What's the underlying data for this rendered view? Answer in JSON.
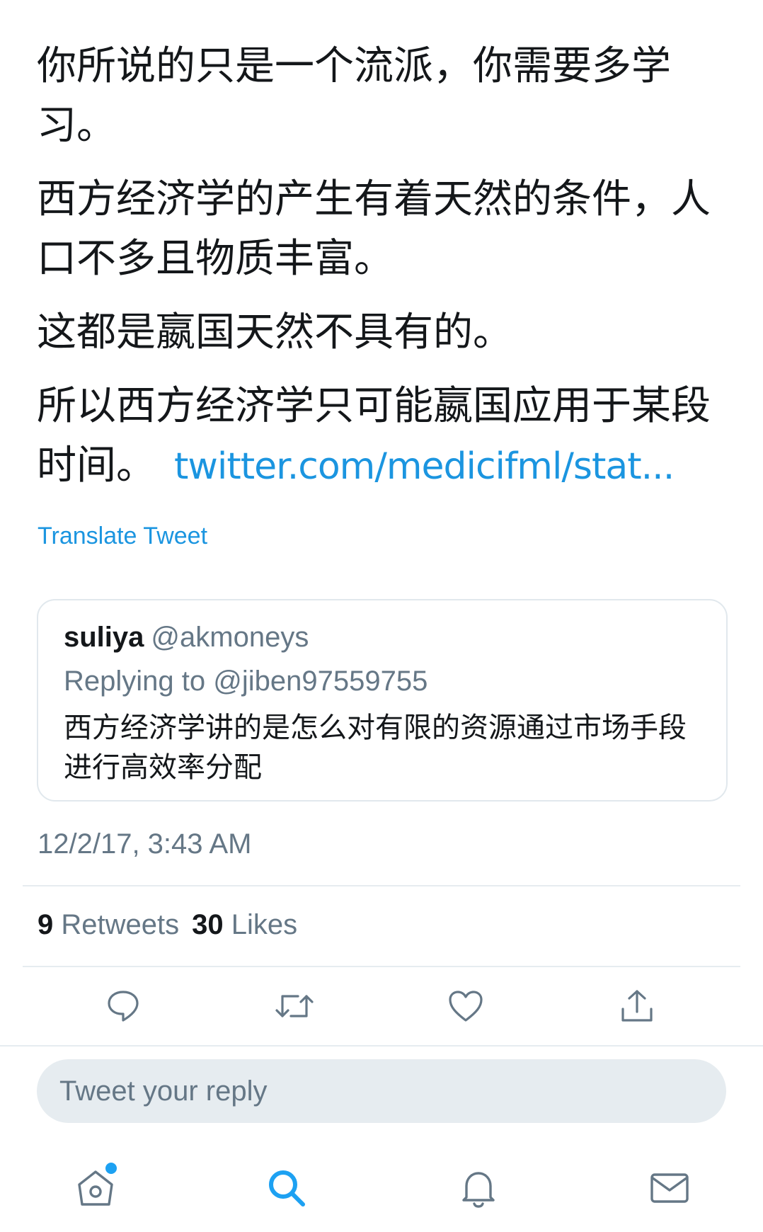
{
  "tweet": {
    "paragraphs": [
      "你所说的只是一个流派，你需要多学习。",
      "西方经济学的产生有着天然的条件，人口不多且物质丰富。",
      "这都是嬴国天然不具有的。",
      "所以西方经济学只可能嬴国应用于某段时间。"
    ],
    "link": "twitter.com/medicifml/stat...",
    "translate_label": "Translate Tweet",
    "timestamp": "12/2/17, 3:43 AM"
  },
  "quoted": {
    "name": "suliya",
    "handle": "@akmoneys",
    "replying_to": "Replying to @jiben97559755",
    "text": "西方经济学讲的是怎么对有限的资源通过市场手段进行高效率分配"
  },
  "stats": {
    "retweets_count": "9",
    "retweets_label": "Retweets",
    "likes_count": "30",
    "likes_label": "Likes"
  },
  "actions": {
    "icons": [
      "reply-icon",
      "retweet-icon",
      "like-icon",
      "share-icon"
    ]
  },
  "reply": {
    "placeholder": "Tweet your reply"
  },
  "tabbar": {
    "icons": [
      "home-icon",
      "search-icon",
      "notifications-icon",
      "messages-icon"
    ],
    "accent": "#1da1f2",
    "icon_color": "#657786"
  }
}
